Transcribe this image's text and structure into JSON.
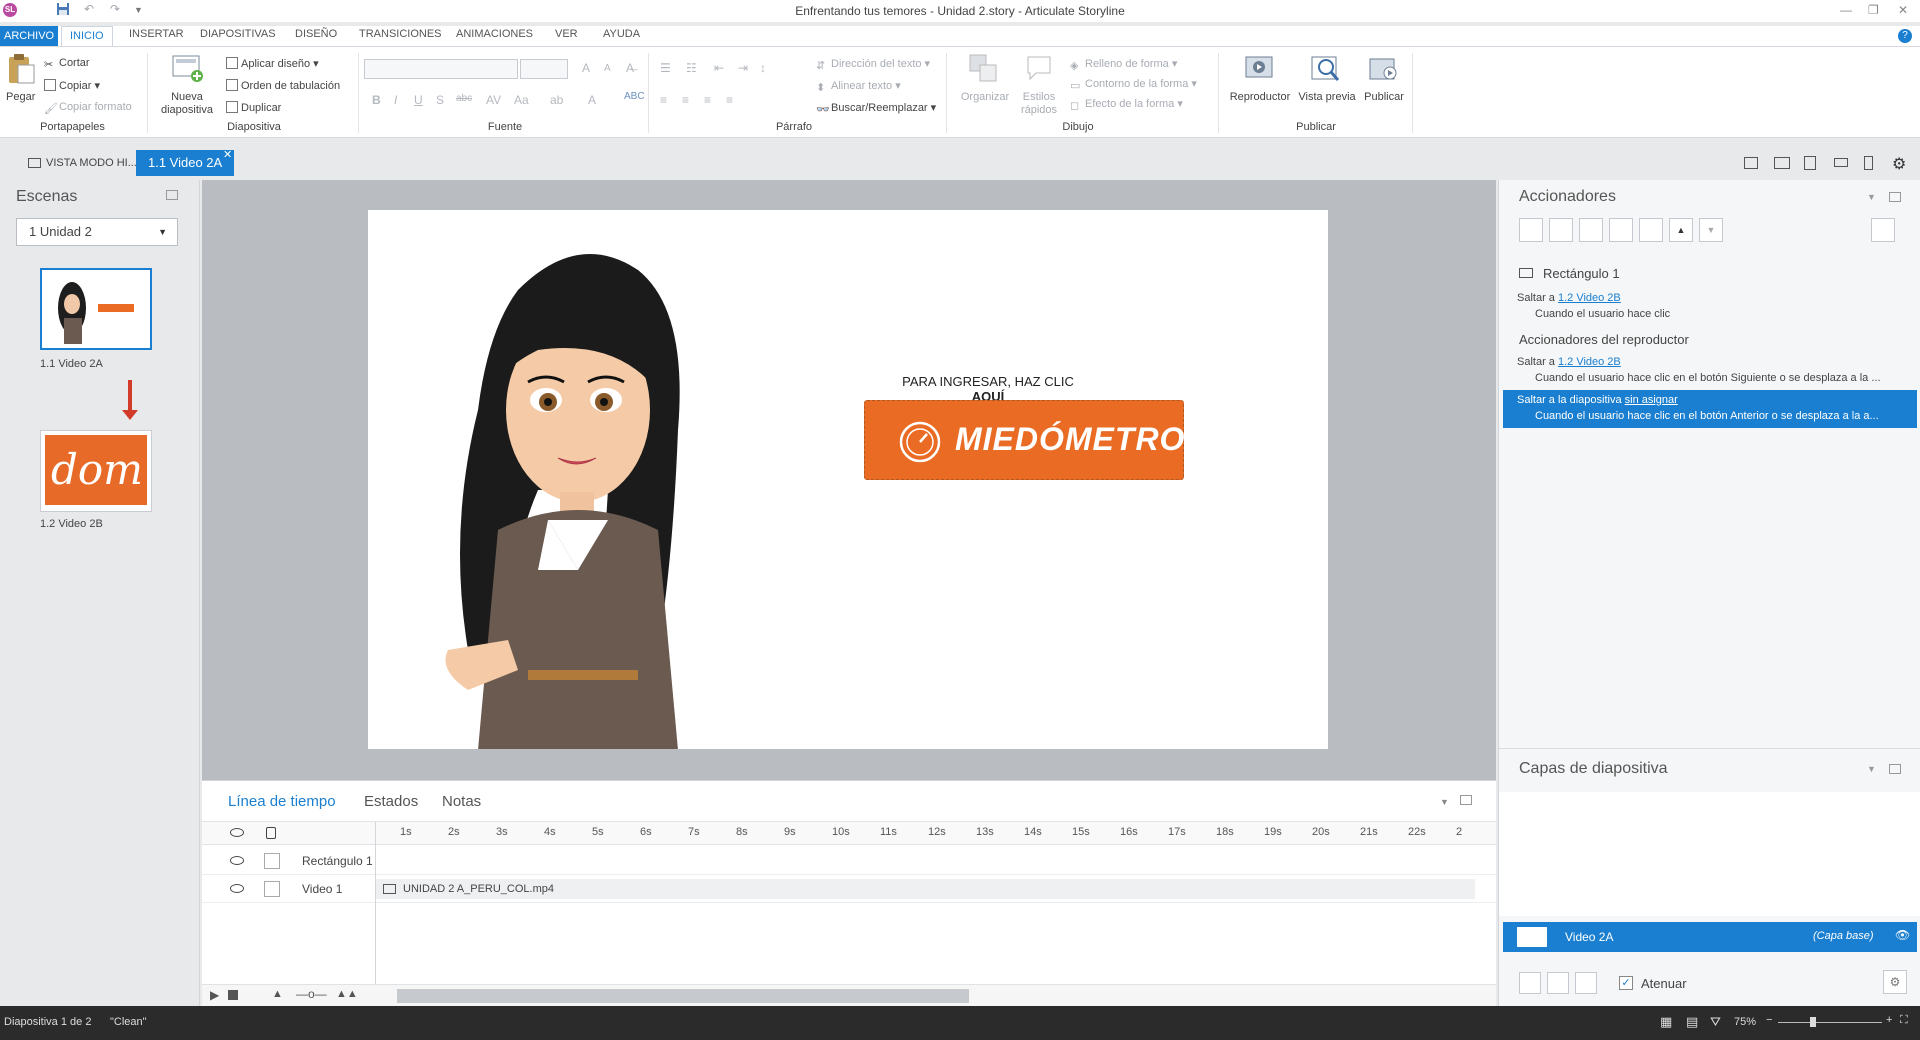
{
  "window": {
    "title": "Enfrentando tus temores - Unidad 2.story - Articulate Storyline",
    "logo": "SL"
  },
  "ribbon_tabs": [
    "ARCHIVO",
    "INICIO",
    "INSERTAR",
    "DIAPOSITIVAS",
    "DISEÑO",
    "TRANSICIONES",
    "ANIMACIONES",
    "VER",
    "AYUDA"
  ],
  "ribbon": {
    "portapapeles": {
      "label": "Portapapeles",
      "pegar": "Pegar",
      "cortar": "Cortar",
      "copiar": "Copiar",
      "copiar_formato": "Copiar formato"
    },
    "diapositiva": {
      "label": "Diapositiva",
      "nueva": "Nueva diapositiva",
      "aplicar_diseno": "Aplicar diseño",
      "orden_tab": "Orden de tabulación",
      "duplicar": "Duplicar"
    },
    "fuente": {
      "label": "Fuente"
    },
    "parrafo": {
      "label": "Párrafo",
      "direccion": "Dirección del texto",
      "alinear": "Alinear texto",
      "buscar": "Buscar/Reemplazar"
    },
    "dibujo": {
      "label": "Dibujo",
      "organizar": "Organizar",
      "estilos": "Estilos rápidos",
      "relleno": "Relleno de forma",
      "contorno": "Contorno de la forma",
      "efecto": "Efecto de la forma"
    },
    "publicar": {
      "label": "Publicar",
      "reproductor": "Reproductor",
      "vista_previa": "Vista previa",
      "publicar": "Publicar"
    }
  },
  "doc_tabs": {
    "story_view": "VISTA MODO HI...",
    "slide": "1.1 Video 2A"
  },
  "scenes": {
    "title": "Escenas",
    "selected_scene": "1 Unidad 2",
    "slides": [
      {
        "label": "1.1 Video 2A"
      },
      {
        "label": "1.2 Video 2B",
        "thumb_text": "dom"
      }
    ]
  },
  "slide": {
    "caption_prefix": "PARA INGRESAR, HAZ CLIC ",
    "caption_bold": "AQUÍ",
    "button_label": "MIEDÓMETRO",
    "button_color": "#ea6b24"
  },
  "timeline": {
    "tabs": [
      "Línea de tiempo",
      "Estados",
      "Notas"
    ],
    "ticks": [
      "1s",
      "2s",
      "3s",
      "4s",
      "5s",
      "6s",
      "7s",
      "8s",
      "9s",
      "10s",
      "11s",
      "12s",
      "13s",
      "14s",
      "15s",
      "16s",
      "17s",
      "18s",
      "19s",
      "20s",
      "21s",
      "22s",
      "2"
    ],
    "rows": [
      {
        "name": "Rectángulo 1",
        "clip": ""
      },
      {
        "name": "Video 1",
        "clip": "UNIDAD 2 A_PERU_COL.mp4"
      }
    ]
  },
  "triggers": {
    "title": "Accionadores",
    "object_name": "Rectángulo 1",
    "items": [
      {
        "action": "Saltar a ",
        "target": "1.2 Video 2B",
        "condition": "Cuando el usuario hace clic"
      }
    ],
    "player_title": "Accionadores del reproductor",
    "player_items": [
      {
        "action": "Saltar a ",
        "target": "1.2 Video 2B",
        "condition": "Cuando el usuario hace clic en el botón Siguiente o se desplaza a la ..."
      },
      {
        "action": "Saltar a la diapositiva ",
        "target": "sin asignar",
        "condition": "Cuando el usuario hace clic en el botón Anterior o se desplaza a la a..."
      }
    ]
  },
  "layers": {
    "title": "Capas de diapositiva",
    "base_name": "Video 2A",
    "base_tag": "(Capa base)",
    "dim_label": "Atenuar"
  },
  "status": {
    "slide_info": "Diapositiva 1 de 2",
    "theme": "\"Clean\"",
    "zoom": "75%"
  },
  "colors": {
    "accent": "#1a7fd0",
    "orange": "#ea6b24"
  }
}
